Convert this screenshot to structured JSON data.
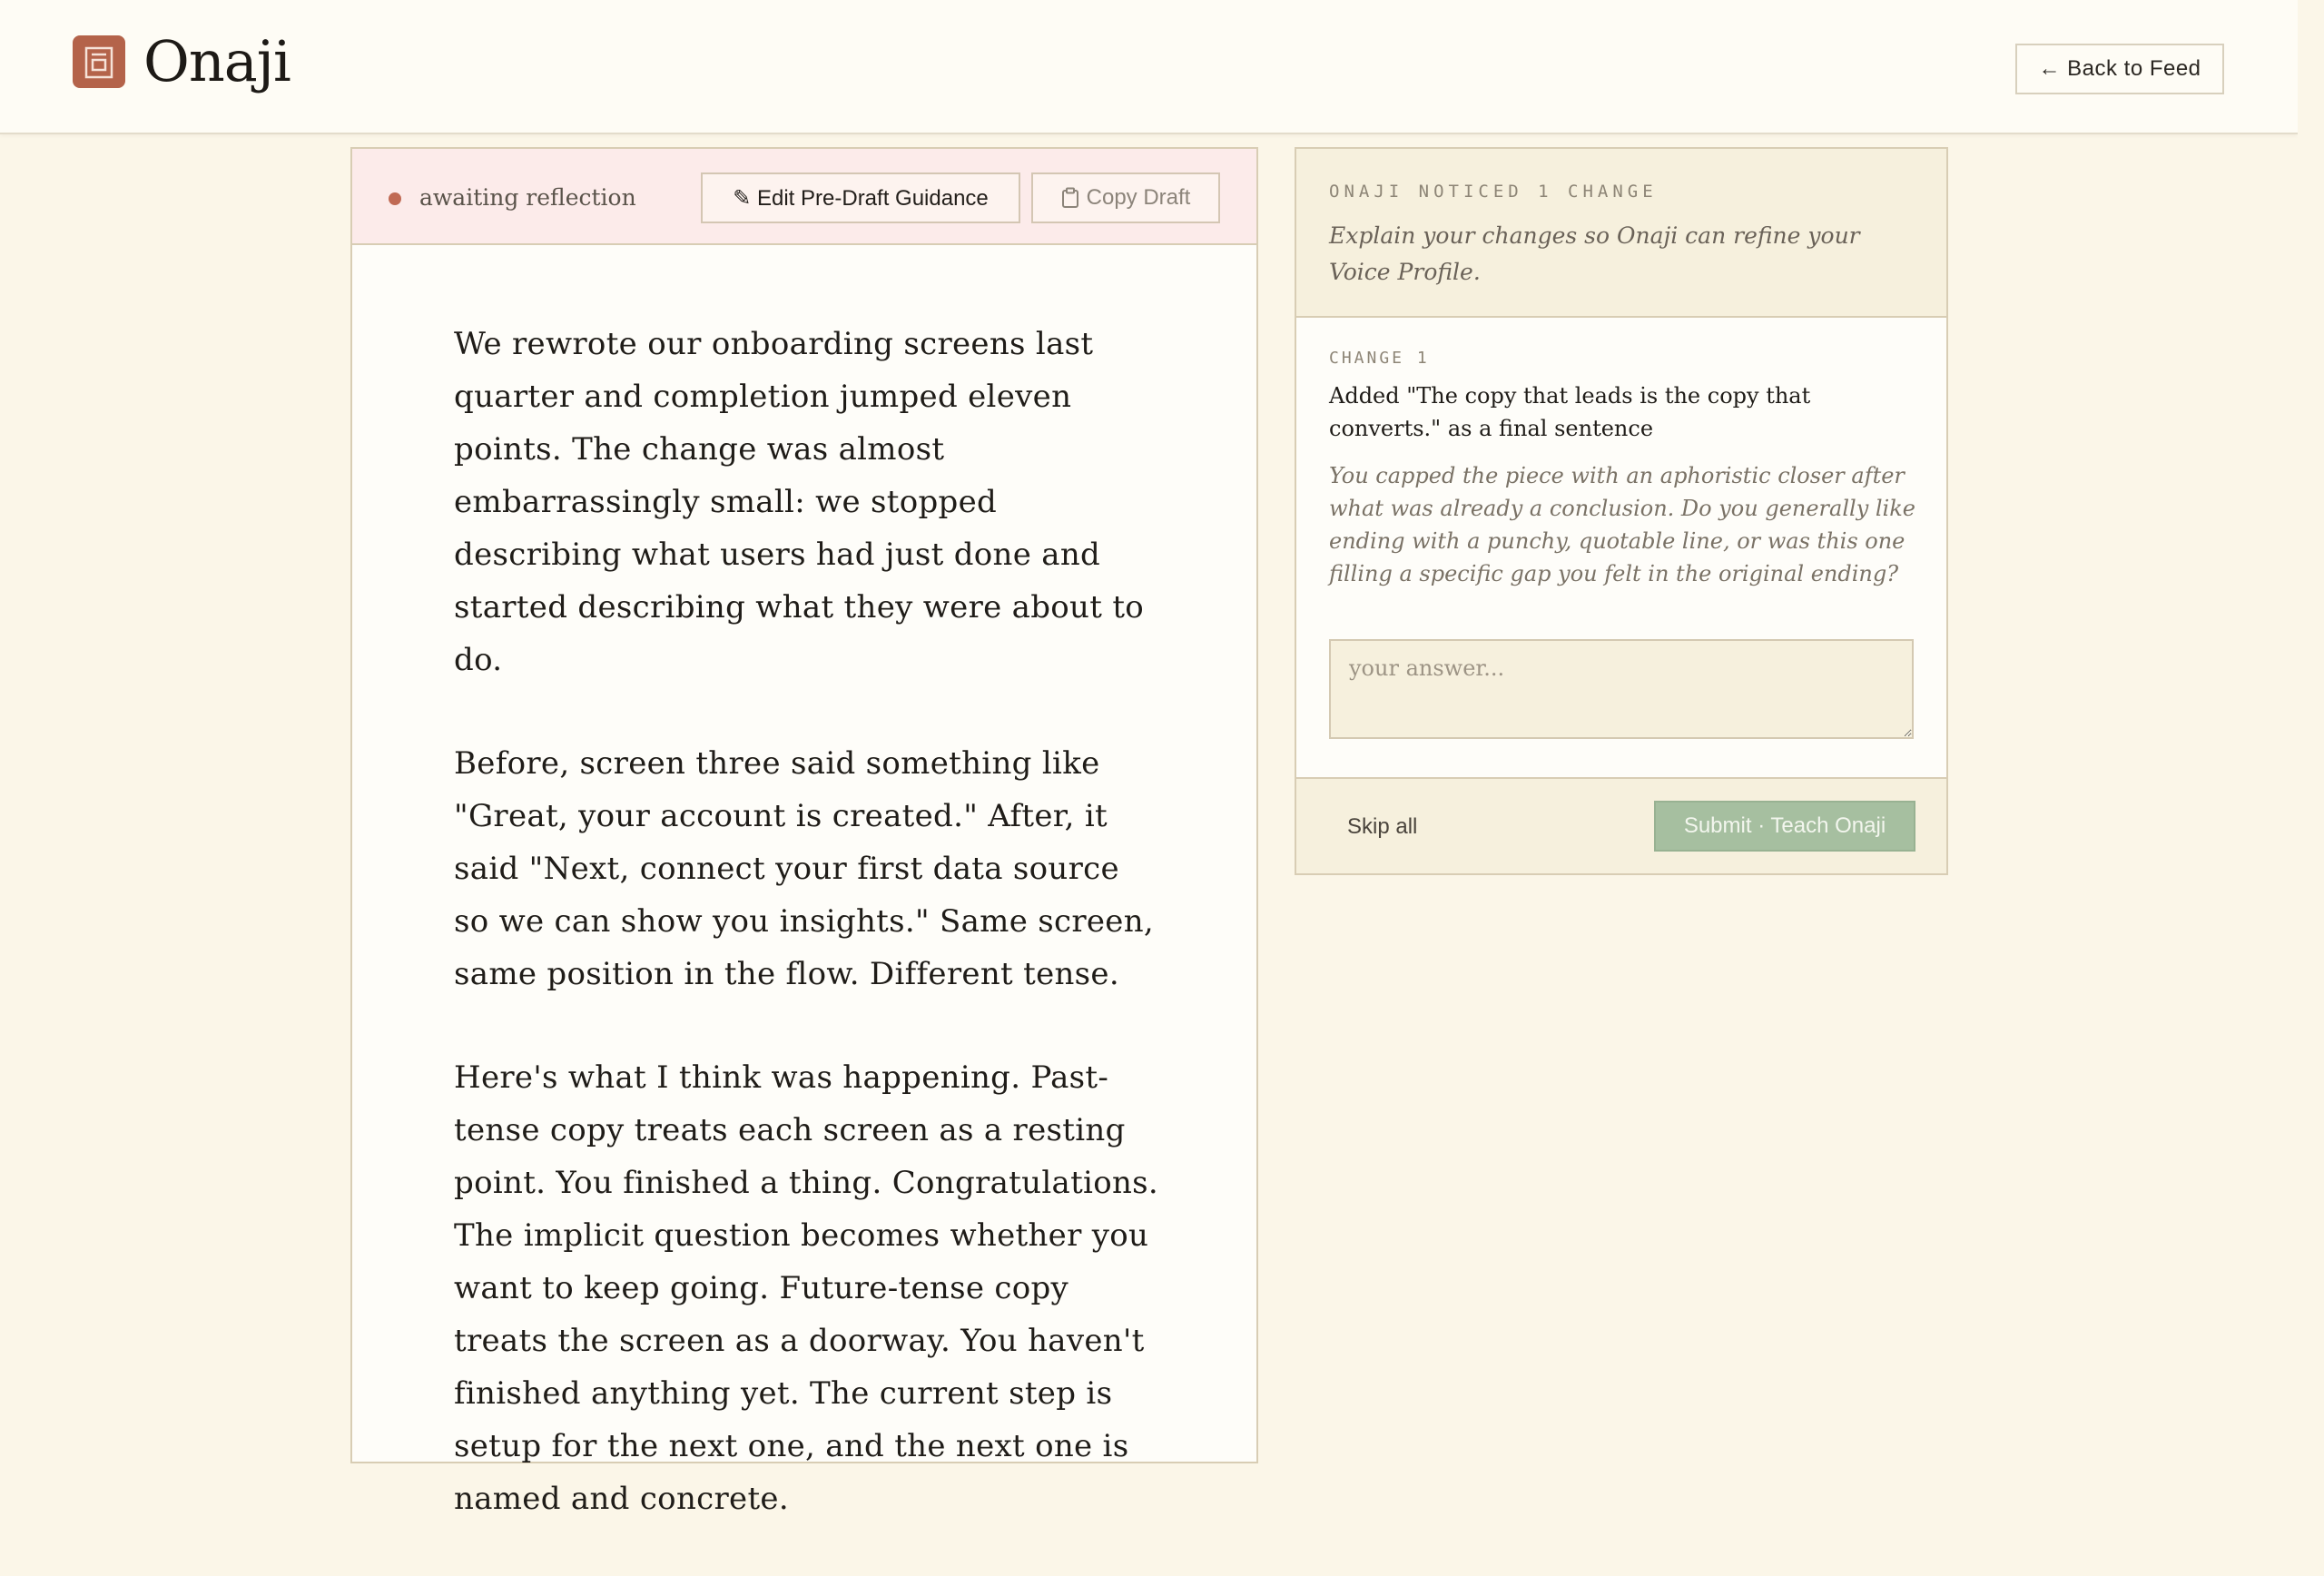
{
  "app": {
    "name": "Onaji"
  },
  "header": {
    "back_label": "← Back to Feed"
  },
  "draft": {
    "status": "awaiting reflection",
    "edit_label": "✎ Edit Pre-Draft Guidance",
    "copy_label": "Copy Draft",
    "paragraphs": [
      "We rewrote our onboarding screens last quarter and completion jumped eleven points. The change was almost embarrassingly small: we stopped describing what users had just done and started describing what they were about to do.",
      "Before, screen three said something like \"Great, your account is created.\" After, it said \"Next, connect your first data source so we can show you insights.\" Same screen, same position in the flow. Different tense.",
      "Here's what I think was happening. Past-tense copy treats each screen as a resting point. You finished a thing. Congratulations. The implicit question becomes whether you want to keep going. Future-tense copy treats the screen as a doorway. You haven't finished anything yet. The current step is setup for the next one, and the next one is named and concrete."
    ]
  },
  "changes": {
    "noticed": "ONAJI NOTICED 1 CHANGE",
    "intro": "Explain your changes so Onaji can refine your Voice Profile.",
    "items": [
      {
        "label": "CHANGE 1",
        "description": "Added \"The copy that leads is the copy that converts.\" as a final sentence",
        "question": "You capped the piece with an aphoristic closer after what was already a conclusion. Do you generally like ending with a punchy, quotable line, or was this one filling a specific gap you felt in the original ending?",
        "answer_placeholder": "your answer..."
      }
    ],
    "skip_label": "Skip all",
    "submit_label": "Submit · Teach Onaji"
  },
  "colors": {
    "accent": "#b4634a",
    "background": "#fbf6e8",
    "submit": "#a6bfa0",
    "status_dot": "#c06a54"
  }
}
